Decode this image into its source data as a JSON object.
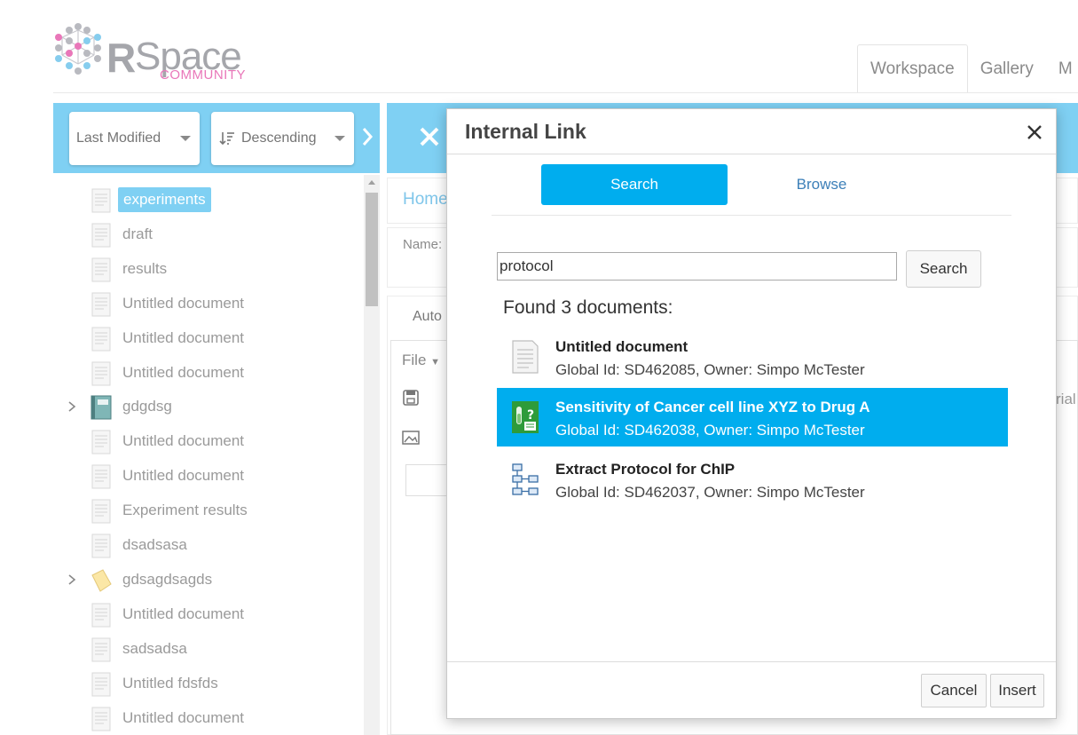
{
  "brand": {
    "r": "R",
    "space": "Space",
    "community": "COMMUNITY",
    "accent": "#e977b9",
    "primary": "#00adee"
  },
  "top_tabs": [
    {
      "label": "Workspace"
    },
    {
      "label": "Gallery"
    },
    {
      "label": "M"
    }
  ],
  "left_panel": {
    "sort_field": "Last Modified",
    "sort_order": "Descending",
    "items": [
      {
        "label": "experiments",
        "icon": "document-icon",
        "selected": true
      },
      {
        "label": "draft",
        "icon": "document-icon"
      },
      {
        "label": "results",
        "icon": "document-icon"
      },
      {
        "label": "Untitled document",
        "icon": "document-icon"
      },
      {
        "label": "Untitled document",
        "icon": "document-icon"
      },
      {
        "label": "Untitled document",
        "icon": "document-icon"
      },
      {
        "label": "gdgdsg",
        "icon": "notebook-icon",
        "expandable": true
      },
      {
        "label": "Untitled document",
        "icon": "document-icon"
      },
      {
        "label": "Untitled document",
        "icon": "document-icon"
      },
      {
        "label": "Experiment results",
        "icon": "document-icon"
      },
      {
        "label": "dsadsasa",
        "icon": "document-icon"
      },
      {
        "label": "gdsagdsagds",
        "icon": "folder-icon",
        "expandable": true
      },
      {
        "label": "Untitled document",
        "icon": "document-icon"
      },
      {
        "label": "sadsadsa",
        "icon": "document-icon"
      },
      {
        "label": "Untitled fdsfds",
        "icon": "document-icon"
      },
      {
        "label": "Untitled document",
        "icon": "document-icon"
      }
    ]
  },
  "main_bg": {
    "breadcrumb": "Home",
    "name_label": "Name:",
    "tab_partial": "Auto",
    "file_menu": "File",
    "font_partial": "rial"
  },
  "modal": {
    "title": "Internal Link",
    "tab_search": "Search",
    "tab_browse": "Browse",
    "search_value": "protocol",
    "search_button": "Search",
    "found_text": "Found 3 documents:",
    "results": [
      {
        "title": "Untitled document",
        "meta": "Global Id: SD462085, Owner: Simpo McTester",
        "icon": "document-icon",
        "selected": false
      },
      {
        "title": "Sensitivity of Cancer cell line XYZ to Drug A",
        "meta": "Global Id: SD462038, Owner: Simpo McTester",
        "icon": "experiment-template-icon",
        "selected": true
      },
      {
        "title": "Extract Protocol for ChIP",
        "meta": "Global Id: SD462037, Owner: Simpo McTester",
        "icon": "protocol-flowchart-icon",
        "selected": false
      }
    ],
    "cancel_label": "Cancel",
    "insert_label": "Insert"
  }
}
